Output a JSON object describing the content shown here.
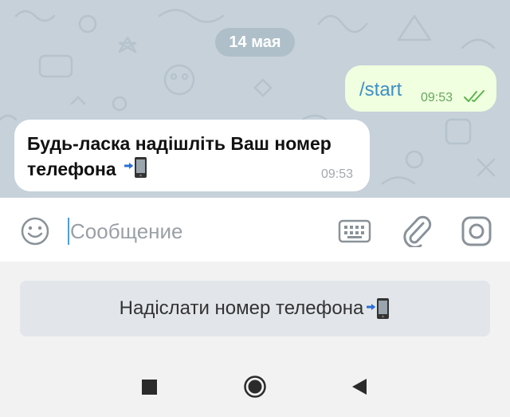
{
  "chat": {
    "date_pill": "14 мая",
    "outgoing": {
      "text": "/start",
      "time": "09:53",
      "status_icon": "double-check-icon"
    },
    "incoming": {
      "text": "Будь-ласка надішліть Ваш номер телефона",
      "emoji_icon": "mobile-phone-arrow-icon",
      "time": "09:53"
    }
  },
  "input": {
    "placeholder": "Сообщение",
    "value": ""
  },
  "reply_keyboard": {
    "button_label": "Надіслати номер телефона",
    "button_icon": "mobile-phone-arrow-icon"
  },
  "colors": {
    "chat_bg": "#c6d1da",
    "outgoing_bubble": "#efffdf",
    "outgoing_text": "#3f8fc5",
    "accent": "#4e9ed6"
  },
  "nav_icons": [
    "recents-square-icon",
    "home-circle-icon",
    "back-triangle-icon"
  ]
}
